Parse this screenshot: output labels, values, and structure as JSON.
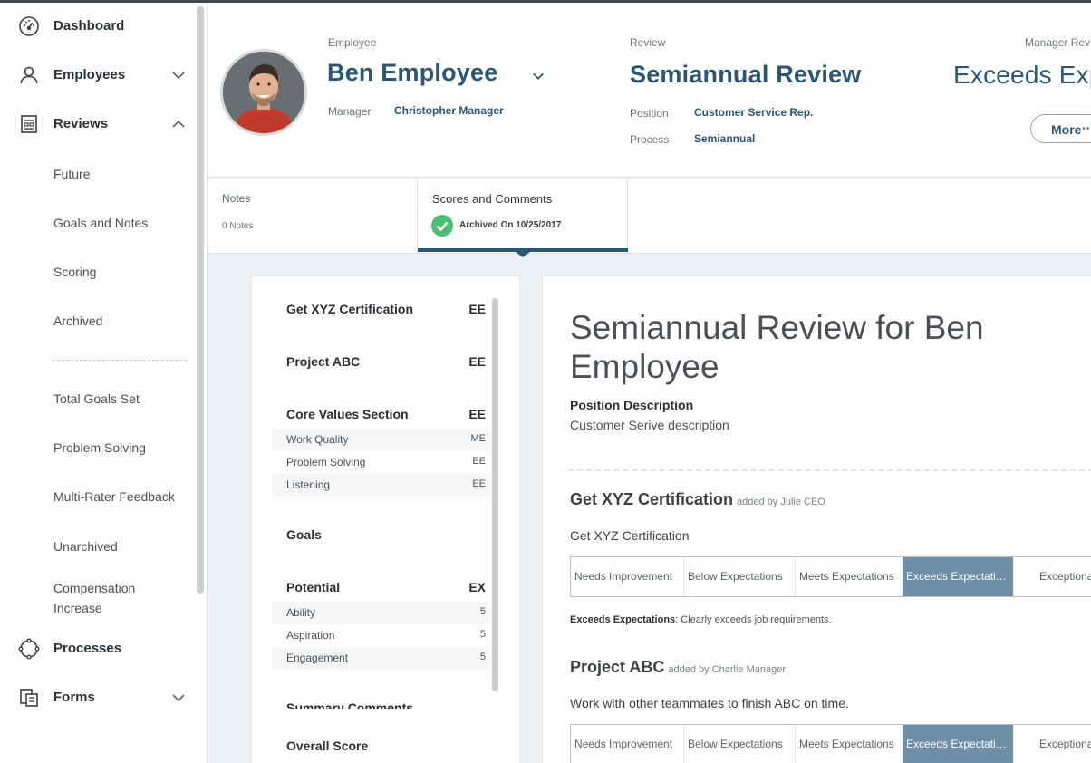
{
  "sidebar": {
    "items": [
      {
        "label": "Dashboard",
        "icon": "dashboard-icon"
      },
      {
        "label": "Employees",
        "icon": "employees-icon"
      },
      {
        "label": "Reviews",
        "icon": "reviews-icon"
      },
      {
        "label": "Processes",
        "icon": "processes-icon"
      },
      {
        "label": "Forms",
        "icon": "forms-icon"
      }
    ],
    "sub_items": [
      "Future",
      "Goals and Notes",
      "Scoring",
      "Archived"
    ],
    "sub_items_2": [
      "Total Goals Set",
      "Problem Solving",
      "Multi-Rater Feedback",
      "Unarchived",
      "Compensation Increase"
    ]
  },
  "header": {
    "employee_label": "Employee",
    "employee_name": "Ben Employee",
    "manager_label": "Manager",
    "manager_name": "Christopher Manager",
    "review_label": "Review",
    "review_name": "Semiannual Review",
    "position_label": "Position",
    "position_value": "Customer Service Rep.",
    "process_label": "Process",
    "process_value": "Semiannual",
    "manager_review_label": "Manager Rev",
    "manager_review_value": "Exceeds Exp",
    "more_label": "More",
    "more_dots": "···"
  },
  "tabs": {
    "notes": {
      "title": "Notes",
      "sub": "0 Notes"
    },
    "scores": {
      "title": "Scores and Comments",
      "sub": "Archived On 10/25/2017"
    }
  },
  "score_panel": {
    "sections": [
      {
        "name": "Get XYZ Certification",
        "value": "EE"
      },
      {
        "name": "Project ABC",
        "value": "EE"
      },
      {
        "name": "Core Values Section",
        "value": "EE"
      },
      {
        "name": "Goals",
        "value": ""
      },
      {
        "name": "Potential",
        "value": "EX"
      }
    ],
    "core_values": [
      {
        "name": "Work Quality",
        "value": "ME"
      },
      {
        "name": "Problem Solving",
        "value": "EE"
      },
      {
        "name": "Listening",
        "value": "EE"
      }
    ],
    "potential": [
      {
        "name": "Ability",
        "value": "5"
      },
      {
        "name": "Aspiration",
        "value": "5"
      },
      {
        "name": "Engagement",
        "value": "5"
      }
    ],
    "summary_comments": "Summary Comments",
    "overall_score": "Overall Score"
  },
  "main": {
    "title": "Semiannual Review for Ben Employee",
    "position_heading": "Position Description",
    "position_description": "Customer Serive description",
    "rating_options": [
      "Needs Improvement",
      "Below Expectations",
      "Meets Expectations",
      "Exceeds Expectati…",
      "Exceptiona"
    ],
    "goals": [
      {
        "title": "Get XYZ Certification",
        "added_by": "added by Julie CEO",
        "description": "Get XYZ Certification",
        "selected": "Exceeds Expectati…",
        "note_label": "Exceeds Expectations",
        "note_text": ": Clearly exceeds job requirements."
      },
      {
        "title": "Project ABC",
        "added_by": "added by Charlie Manager",
        "description": "Work with other teammates to finish ABC on time.",
        "selected": "Exceeds Expectati…"
      }
    ]
  },
  "colors": {
    "accent": "#2a5677",
    "selected_rating": "#6f8fa8",
    "check": "#4dbd74"
  }
}
